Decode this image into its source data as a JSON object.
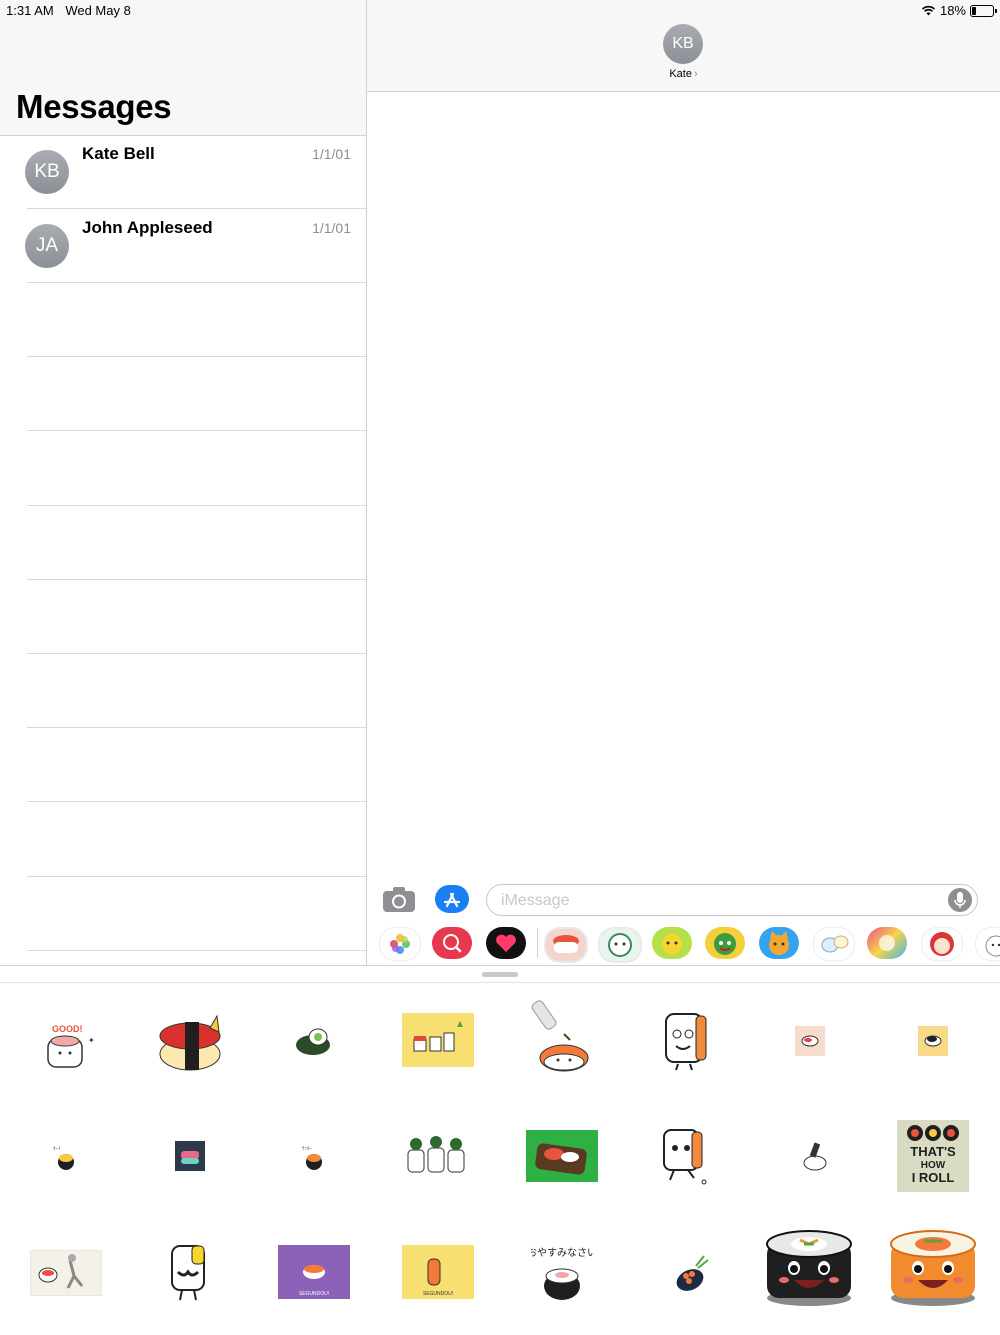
{
  "status_bar": {
    "time": "1:31 AM",
    "date": "Wed May 8",
    "battery_text": "18%",
    "battery_level": 0.18
  },
  "sidebar": {
    "title": "Messages",
    "conversations": [
      {
        "initials": "KB",
        "name": "Kate Bell",
        "date": "1/1/01"
      },
      {
        "initials": "JA",
        "name": "John Appleseed",
        "date": "1/1/01"
      }
    ]
  },
  "chat": {
    "contact_initials": "KB",
    "contact_name": "Kate",
    "input_placeholder": "iMessage"
  },
  "app_strip": {
    "items": [
      "photos-app",
      "image-search-app",
      "digital-touch-app",
      "sushi-sticker-app",
      "green-character-sticker-app",
      "yellow-character-sticker-app",
      "watermelon-sticker-app",
      "cat-sticker-app",
      "bird-sticker-app",
      "colorful-sticker-app",
      "red-hood-sticker-app",
      "cat-white-sticker-app"
    ]
  },
  "stickers": {
    "row1": [
      "sushi-good-sticker",
      "cat-sushi-sticker",
      "maki-sticker",
      "sushi-friends-sticker",
      "soy-sauce-sushi-sticker",
      "sushi-face-sticker",
      "small-sushi-sticker",
      "small-sushi-sticker-2"
    ],
    "row2": [
      "small-sushi-3-sticker",
      "dark-sushi-sticker",
      "small-sushi-4-sticker",
      "sushi-trio-sticker",
      "bento-sticker",
      "sushi-walking-sticker",
      "sushi-pen-sticker",
      "thats-how-i-roll-sticker"
    ],
    "row3": [
      "sushi-running-sticker",
      "mustache-sushi-sticker",
      "purple-sushi-sticker",
      "carrot-sushi-sticker",
      "oyasumi-sushi-sticker",
      "roe-sushi-sticker",
      "maki-face-sticker",
      "salmon-maki-face-sticker"
    ],
    "good_text": "GOOD!",
    "roll_text_1": "THAT'S",
    "roll_text_2": "HOW",
    "roll_text_3": "I ROLL",
    "oyasumi_text": "おやすみなさい",
    "segundou_text": "SEGUNDOU!"
  }
}
